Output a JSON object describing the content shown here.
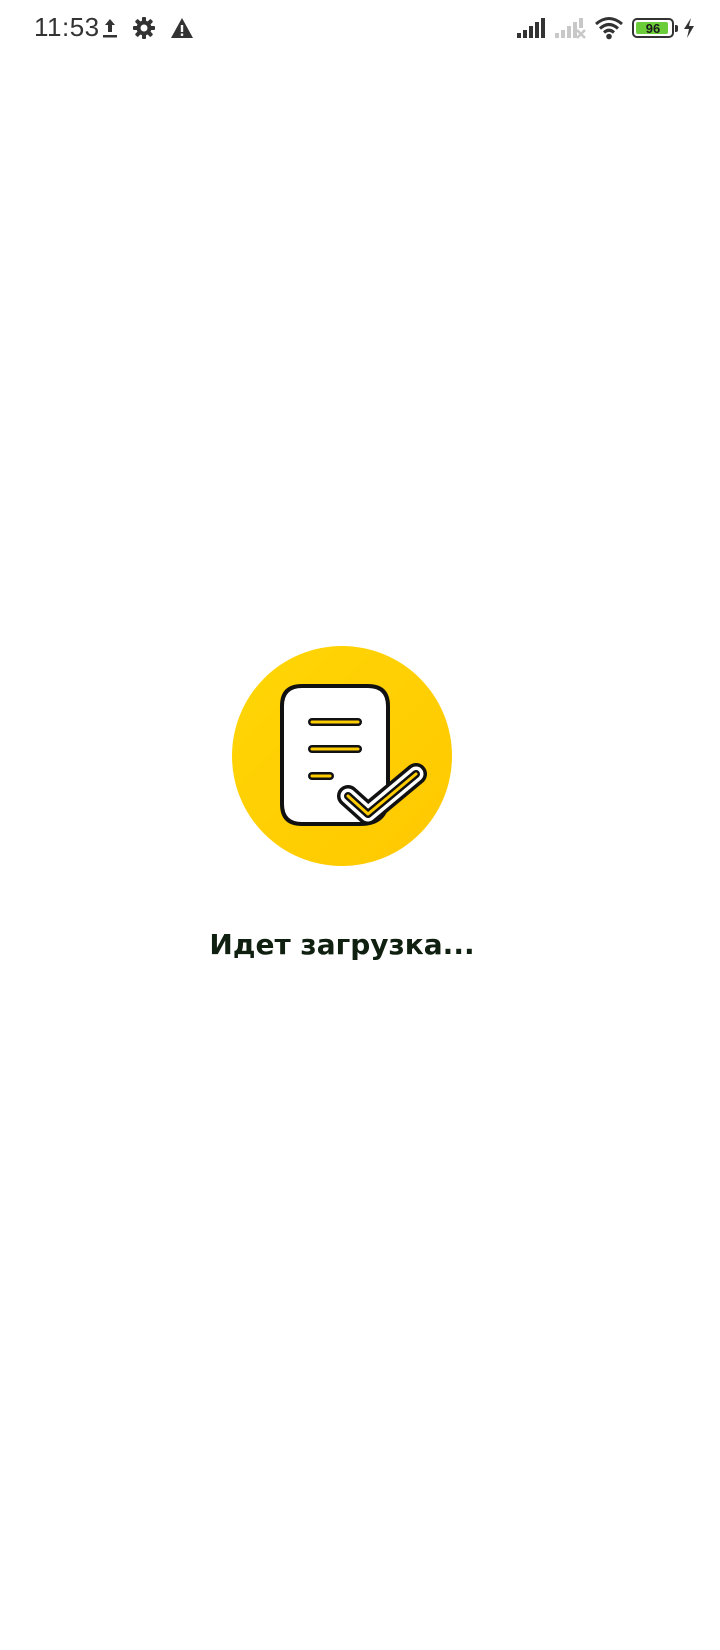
{
  "status_bar": {
    "time": "11:53",
    "battery_level": 96,
    "battery_text": "96",
    "battery_color": "#6ccd3b",
    "left_icons": [
      "upload-icon",
      "settings-icon",
      "warning-icon"
    ],
    "right_icons": [
      "signal-icon",
      "signal-no-sim-icon",
      "wifi-icon",
      "battery-icon",
      "charging-icon"
    ]
  },
  "loader": {
    "logo_icon": "document-check-icon",
    "accent_color": "#ffd000",
    "text": "Идет загрузка..."
  }
}
